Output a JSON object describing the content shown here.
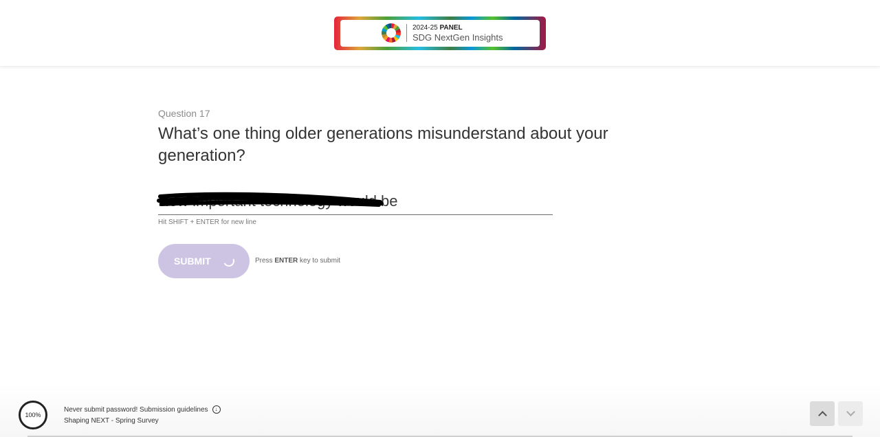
{
  "header": {
    "logo_line1_year": "2024-25",
    "logo_line1_label": "PANEL",
    "logo_line2": "SDG NextGen Insights"
  },
  "question": {
    "number_label": "Question 17",
    "title": "What’s one thing older generations misunderstand about your generation?"
  },
  "answer": {
    "value": "How important technology would be",
    "hint": "Hit SHIFT + ENTER for new line"
  },
  "submit": {
    "label": "SUBMIT",
    "press_prefix": "Press",
    "press_key": "ENTER",
    "press_suffix": "key to submit"
  },
  "footer": {
    "progress": "100%",
    "note": "Never submit password! Submission guidelines",
    "survey_name": "Shaping NEXT - Spring Survey"
  },
  "colors": {
    "submit_bg": "#cdc4e4",
    "text": "#333333"
  },
  "icons": [
    "sdg-wheel-icon",
    "info-icon",
    "spinner-icon",
    "chevron-up-icon",
    "chevron-down-icon"
  ]
}
